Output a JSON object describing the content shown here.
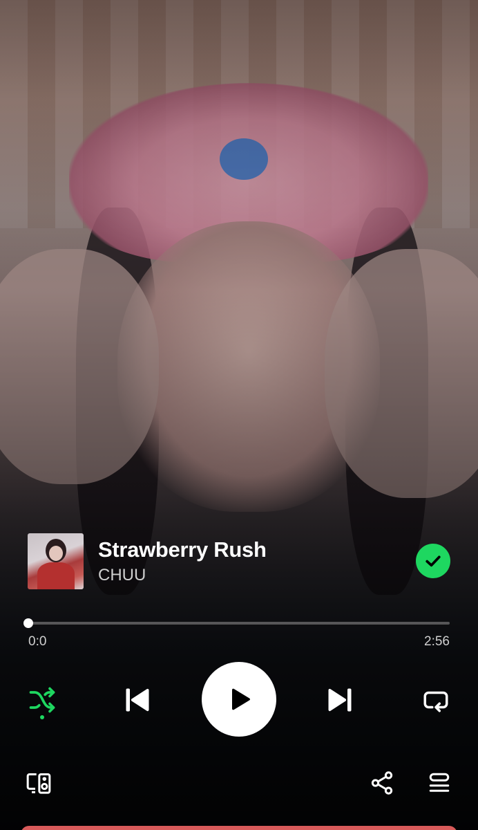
{
  "track": {
    "title": "Strawberry Rush",
    "artist": "CHUU",
    "liked": true
  },
  "playback": {
    "elapsed": "0:0",
    "duration": "2:56",
    "progress_fraction": 0.0,
    "is_playing": false,
    "shuffle_on": true,
    "repeat": "off"
  },
  "icons": {
    "liked": "check-circle-icon",
    "shuffle": "shuffle-icon",
    "previous": "skip-previous-icon",
    "play": "play-icon",
    "next": "skip-next-icon",
    "repeat": "repeat-icon",
    "devices": "connect-device-icon",
    "share": "share-icon",
    "queue": "queue-icon"
  },
  "colors": {
    "accent": "#1ed760",
    "lyrics_card": "#d85a5a"
  }
}
